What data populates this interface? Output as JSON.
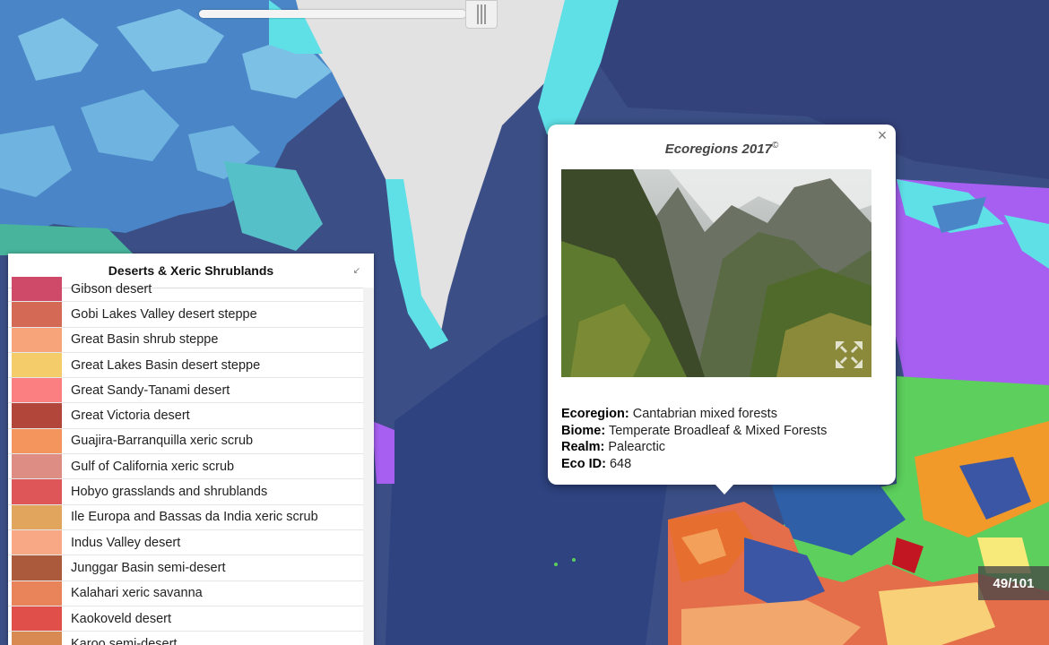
{
  "legend": {
    "title": "Deserts & Xeric Shrublands",
    "collapse_icon": "collapse-arrow-icon",
    "items": [
      {
        "label": "Gibson desert",
        "color": "#cf4a68"
      },
      {
        "label": "Gobi Lakes Valley desert steppe",
        "color": "#d46a55"
      },
      {
        "label": "Great Basin shrub steppe",
        "color": "#f8a47a"
      },
      {
        "label": "Great Lakes Basin desert steppe",
        "color": "#f4cc6a"
      },
      {
        "label": "Great Sandy-Tanami desert",
        "color": "#fb7e80"
      },
      {
        "label": "Great Victoria desert",
        "color": "#b3463a"
      },
      {
        "label": "Guajira-Barranquilla xeric scrub",
        "color": "#f4955e"
      },
      {
        "label": "Gulf of California xeric scrub",
        "color": "#de8d84"
      },
      {
        "label": "Hobyo grasslands and shrublands",
        "color": "#df5659"
      },
      {
        "label": "Ile Europa and Bassas da India xeric scrub",
        "color": "#e1a55d"
      },
      {
        "label": "Indus Valley desert",
        "color": "#f9a885"
      },
      {
        "label": "Junggar Basin semi-desert",
        "color": "#ab5a3c"
      },
      {
        "label": "Kalahari xeric savanna",
        "color": "#e8835a"
      },
      {
        "label": "Kaokoveld desert",
        "color": "#e14f4b"
      },
      {
        "label": "Karoo semi-desert",
        "color": "#d98a52"
      }
    ]
  },
  "popup": {
    "title": "Ecoregions 2017",
    "title_mark": "©",
    "close_icon": "close-icon",
    "expand_icon": "expand-icon",
    "details": {
      "ecoregion_label": "Ecoregion:",
      "ecoregion_value": "Cantabrian mixed forests",
      "biome_label": "Biome:",
      "biome_value": "Temperate Broadleaf & Mixed Forests",
      "realm_label": "Realm:",
      "realm_value": "Palearctic",
      "ecoid_label": "Eco ID:",
      "ecoid_value": "648"
    }
  },
  "counter": {
    "text": "49/101"
  },
  "colors": {
    "ocean": "#3b4f86",
    "ice": "#e2e2e2",
    "tundra": "#5fb3db",
    "boreal": "#a65ff0",
    "temperate": "#5ccf5c"
  }
}
